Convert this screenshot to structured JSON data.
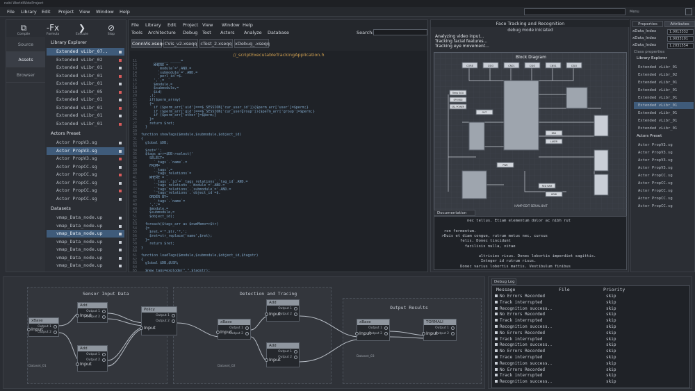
{
  "window": {
    "title": "nebi WorldWideProject",
    "search_label": "Menu"
  },
  "menubar": [
    "File",
    "Library",
    "Edit",
    "Project",
    "View",
    "Window",
    "Help"
  ],
  "toolbar": [
    {
      "label": "Compile",
      "icon": "compile-icon",
      "glyph": "⧉"
    },
    {
      "label": "Formula",
      "icon": "formula-icon",
      "glyph": "-Fx"
    },
    {
      "label": "Execute",
      "icon": "execute-icon",
      "glyph": "❯"
    },
    {
      "label": "Stop",
      "icon": "stop-icon",
      "glyph": "⊘"
    }
  ],
  "side_tabs": [
    "Source",
    "Assets",
    "Browser"
  ],
  "tree": {
    "library": {
      "title": "Library Explorer",
      "items": [
        "Extended vLibr_07..",
        "Extended vLibr_02",
        "Extended vLibr_01",
        "Extended vLibr_01",
        "Extended vLibr_01",
        "Extended vLibr_05",
        "Extended vLibr_01",
        "Extended vLibr_01",
        "Extended vLibr_01",
        "Extended vLibr_01"
      ]
    },
    "actors": {
      "title": "Actors Preset",
      "items": [
        "Actor PropV3.sg",
        "Actor PropV3.sg",
        "Actor PropV3.sg",
        "Actor PropCC.sg",
        "Actor PropCC.sg",
        "Actor PropCC.sg",
        "Actor PropCC.sg",
        "Actor PropCC.sg"
      ]
    },
    "datasets": {
      "title": "Datasets",
      "items": [
        "vmap_Data_node.up",
        "vmap_Data_node.up",
        "vmap_Data_node.up",
        "vmap_Data_node.up",
        "vmap_Data_node.up",
        "vmap_Data_node.up",
        "vmap_Data_node.up"
      ]
    }
  },
  "editor": {
    "menu_row1": [
      "File",
      "Library",
      "Edit",
      "Project",
      "View",
      "Window",
      "Help"
    ],
    "menu_row2": [
      "Tools",
      "Architecture",
      "Debug",
      "Test",
      "Actors",
      "Analyze",
      "Database"
    ],
    "search_label": "Search:",
    "tabs": [
      "ConnVis.xseqq",
      "CVis_v2.xseqq",
      "cTest_2.xseqq",
      "xDebug_.xseqq"
    ],
    "file_title": "//_scriptExecutableTrackingApplication.h",
    "code": [
      "      _______ _____=",
      "      WHERE =",
      "        `module`='.AND.=",
      "        `submodule`='.AND.=",
      "        `perl_id`=$.",
      "      ',`,=",
      "      $module,=",
      "      $submodule,=",
      "      $id)",
      "    ,);",
      "    if($perm_array)",
      "    {=",
      "      if ($perm_arr['uid']===$_SESSION['cur_user_id']){$perm_arr['user']=$perm;}",
      "      if ($perm_arr['gid']===$_SESSION['cur_usergroup']){$perm_arr['group']=$perm;}",
      "      if ($perm_arr['other']=$perm;}",
      "    }=",
      "    return $ret;",
      "  }",
      "",
      "function showTags($module,$submodule,$object_id)",
      "{",
      "  global $DB;",
      "",
      "  $ret='';",
      "  $tags_arr=$DB->select('",
      "    SELECT=",
      "      `_tags`.`name`.=",
      "    FROM=",
      "      `_tags`,=",
      "      `_tags_relations`=",
      "    WHERE =",
      "      `_tags`.`id`=`_tags_relations`.`tag_id`.AND.=",
      "      `_tags_relations`.`module`='.AND.=",
      "      `_tags_relations`.`submodule`='.AND.=",
      "      `_tags_relations`.`object_id`=$.",
      "    ORDER BY=",
      "      `_tags`.`name`=",
      "    ',',=",
      "    $module,=",
      "    $submodule,=",
      "    $object_id);",
      "",
      "  foreach($tags_arr as $numMemo=>$tr)",
      "  {=",
      "    $ret.='*.$tr.'*,';",
      "    $ret=str_replace('name',$ret);",
      "  }=",
      "    return $ret;",
      "}",
      "",
      "function loadTags($module,$submodule,$object_id,$tagstr)",
      "{",
      "  global $DB,$USR;",
      "",
      "  $new_tags=explode(\",\",$tagstr);"
    ]
  },
  "face": {
    "title": "Face Tracking and Recognition",
    "subtitle": "debug mode iniciated",
    "log": [
      "Analyzing video input...",
      "Tracking facial features...",
      "Tracking eye movement..."
    ],
    "diagram_title": "Block Diagram",
    "diagram_caption": "HAMP EDIT SERIAL 8AIT",
    "blocks_top": [
      "CORE",
      "CSIO",
      "CN01",
      "CSIO",
      "CN51",
      "CSIO"
    ],
    "block_misc": [
      "Temp SOU",
      "SPI MIDI",
      "SSL POWER",
      "OUT",
      "CPU",
      "DN1",
      "LASER",
      "PWR",
      "RED RAM",
      "HDMI"
    ],
    "doc_tab": "Documentation",
    "doc_lines": [
      "             nec tellus. Etiam elementum dolor ac nibh rut",
      "                               ",
      "   ron fermentum.",
      "  >Duis et diam congue, rutrum metus nec, cursus",
      "          felis. Donec tincidunt",
      "            facilisis nulla, vitae",
      "",
      "                  ultricies risus. Donec lobortis imperdiet sagittis.",
      "                   Integer id rutrum risus.",
      "          Donec varius lobortis mattis. Vestibulum finibus"
    ]
  },
  "properties": {
    "tabs": [
      "Properties",
      "Attributes"
    ],
    "rows": [
      {
        "label": "xData_Index",
        "value": "1.0013332"
      },
      {
        "label": "xData_Index",
        "value": "1.0033101"
      },
      {
        "label": "xData_Index",
        "value": "1.2031554"
      }
    ],
    "class_label": "Class properties",
    "library_title": "Library Explorer",
    "library_items": [
      "Extended vLibr_01",
      "Extended vLibr_02",
      "Extended vLibr_01",
      "Extended vLibr_01",
      "Extended vLibr_01",
      "Extended vLibr_01",
      "Extended vLibr_01",
      "Extended vLibr_01",
      "Extended vLibr_01"
    ],
    "actors_title": "Actors Preset",
    "actor_items": [
      "Actor PropV3.sg",
      "Actor PropV3.sg",
      "Actor PropV3.sg",
      "Actor PropV3.sg",
      "Actor PropCC.sg",
      "Actor PropCC.sg",
      "Actor PropCC.sg",
      "Actor PropCC.sg",
      "Actor PropCC.sg"
    ]
  },
  "nodes": {
    "regions": [
      "Sensor Input Data",
      "Detection and Tracing",
      "Output Results"
    ],
    "input_label": "Input",
    "output1": "Output 1",
    "output2": "Output 2",
    "headers": [
      "xBase",
      "Add",
      "Add",
      "Policy",
      "xBase",
      "Add",
      "Add",
      "xBase",
      "TORMALI"
    ],
    "dataset_labels": [
      "Dataset_01",
      "Dataset_02",
      "Dataset_03"
    ]
  },
  "debug": {
    "title": "Debug Log",
    "columns": [
      "Message",
      "File",
      "Priority"
    ],
    "rows": [
      {
        "msg": "No Errors Recorded",
        "pri": "skip"
      },
      {
        "msg": "Track interrupted",
        "pri": "skip"
      },
      {
        "msg": "Recognition success..",
        "pri": "skip"
      },
      {
        "msg": "No Errors Recorded",
        "pri": "skip"
      },
      {
        "msg": "Track interrupted",
        "pri": "skip"
      },
      {
        "msg": "Recognition success..",
        "pri": "skip"
      },
      {
        "msg": "No Errors Recorded",
        "pri": "skip"
      },
      {
        "msg": "Track interrupted",
        "pri": "skip"
      },
      {
        "msg": "Recognition success..",
        "pri": "skip"
      },
      {
        "msg": "No Errors Recorded",
        "pri": "skip"
      },
      {
        "msg": "Trace interrupted",
        "pri": "skip"
      },
      {
        "msg": "Recognition success..",
        "pri": "skip"
      },
      {
        "msg": "No Errors Recorded",
        "pri": "skip"
      },
      {
        "msg": "Track interrupted",
        "pri": "skip"
      },
      {
        "msg": "Recognition success..",
        "pri": "skip"
      }
    ]
  }
}
